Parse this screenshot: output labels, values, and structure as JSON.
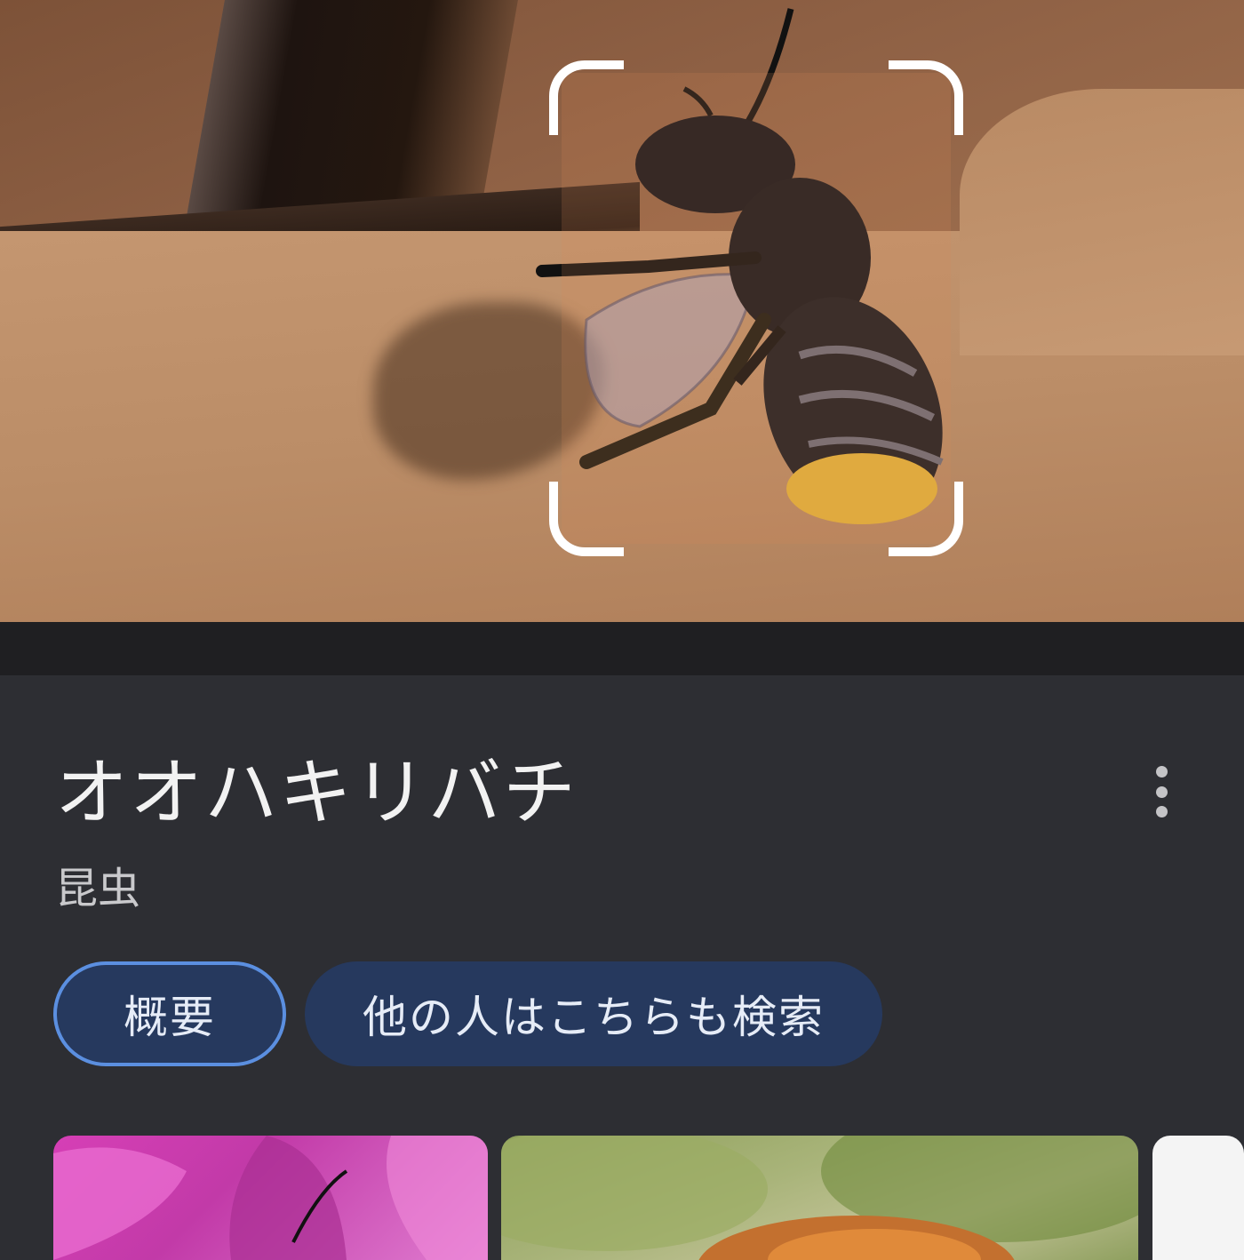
{
  "result": {
    "title": "オオハキリバチ",
    "subtitle": "昆虫"
  },
  "tabs": [
    {
      "label": "概要",
      "selected": true
    },
    {
      "label": "他の人はこちらも検索",
      "selected": false
    }
  ],
  "colors": {
    "sheet_background": "#2d2e33",
    "chip_background": "#26395e",
    "chip_selected_border": "#5b8fe0",
    "title_text": "#f2f2f2",
    "subtitle_text": "#c9c9cc"
  },
  "icons": {
    "more": "more-vert-icon"
  },
  "thumbnails": [
    {
      "subject": "bee on pink flower"
    },
    {
      "subject": "bee on green leaves"
    },
    {
      "subject": "white image"
    }
  ]
}
